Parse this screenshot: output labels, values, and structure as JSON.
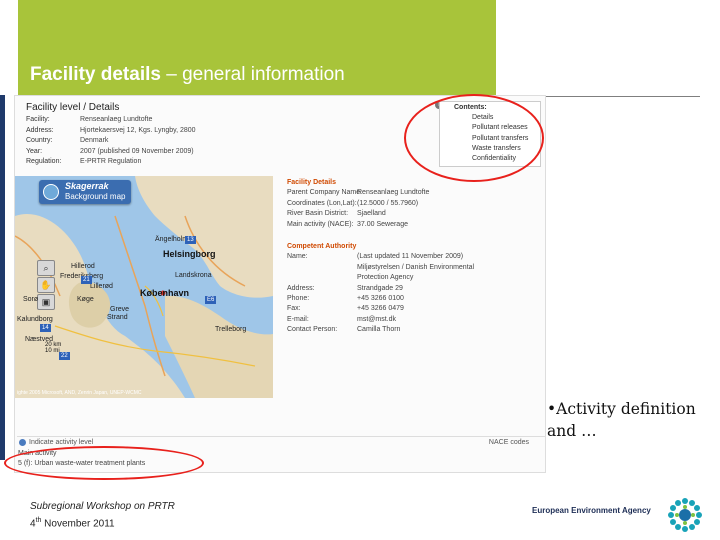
{
  "slide": {
    "title_bold": "Facility details",
    "title_rest": " – general information",
    "bullet": "•Activity definition\nand …",
    "footer_line1": "Subregional Workshop on PRTR",
    "footer_day": "4",
    "footer_sup": "th",
    "footer_rest": " November 2011",
    "agency": "European Environment Agency",
    "colors": {
      "title_bg": "#a8c43a",
      "highlight": "#e8211c",
      "agency": "#1d2d55"
    }
  },
  "screenshot": {
    "header": "Facility level / Details",
    "rows": [
      {
        "k": "Facility:",
        "v": "Renseanlaeg Lundtofte"
      },
      {
        "k": "Address:",
        "v": "Hjortekaersvej 12, Kgs. Lyngby, 2800"
      },
      {
        "k": "Country:",
        "v": "Denmark"
      },
      {
        "k": "Year:",
        "v": "2007 (published 09 November 2009)"
      },
      {
        "k": "Regulation:",
        "v": "E-PRTR Regulation"
      }
    ],
    "contents": {
      "title": "Contents:",
      "items": [
        "Details",
        "Pollutant releases",
        "Pollutant transfers",
        "Waste transfers",
        "Confidentiality"
      ]
    },
    "map": {
      "tab_title": "Skagerrak",
      "tab_button": "Background map",
      "labels": [
        "Ängelholm",
        "Helsingborg",
        "Hillerod",
        "Frederiksberg",
        "Landskrona",
        "Lillerød",
        "København",
        "Greve",
        "Strand",
        "Køge",
        "Trelleborg",
        "Næstved",
        "Sorø",
        "Kalundborg"
      ],
      "shields": [
        "13",
        "21",
        "14",
        "E6",
        "22"
      ],
      "scale_km": "20 km",
      "scale_mi": "10 mi",
      "copyright": "ighte 2005 Microsoft, AND, Zenrin Japan, UNEP-WCMC"
    },
    "facility_details": {
      "section1": "Facility Details",
      "rows1": [
        {
          "k": "Parent Company Name:",
          "v": "Renseanlaeg Lundtofte"
        },
        {
          "k": "Coordinates (Lon,Lat):",
          "v": "(12.5000 / 55.7960)"
        },
        {
          "k": "River Basin District:",
          "v": "Sjaelland"
        },
        {
          "k": "Main activity (NACE):",
          "v": "37.00 Sewerage"
        }
      ],
      "section2": "Competent Authority",
      "rows2": [
        {
          "k": "Name:",
          "v": "(Last updated 11 November 2009)"
        },
        {
          "k": "",
          "v": "Miljøstyrelsen / Danish Environmental"
        },
        {
          "k": "",
          "v": "Protection Agency"
        },
        {
          "k": "Address:",
          "v": "Strandgade 29"
        },
        {
          "k": "Phone:",
          "v": "+45 3266 0100"
        },
        {
          "k": "Fax:",
          "v": "+45 3266 0479"
        },
        {
          "k": "E-mail:",
          "v": "mst@mst.dk"
        },
        {
          "k": "Contact Person:",
          "v": "Camilla Thorn"
        }
      ]
    },
    "bottom_bar": {
      "left": "Indicate activity level",
      "right": "NACE codes"
    },
    "activity": {
      "line1": "Main activity",
      "line2": "5 (f): Urban waste-water treatment plants"
    }
  }
}
